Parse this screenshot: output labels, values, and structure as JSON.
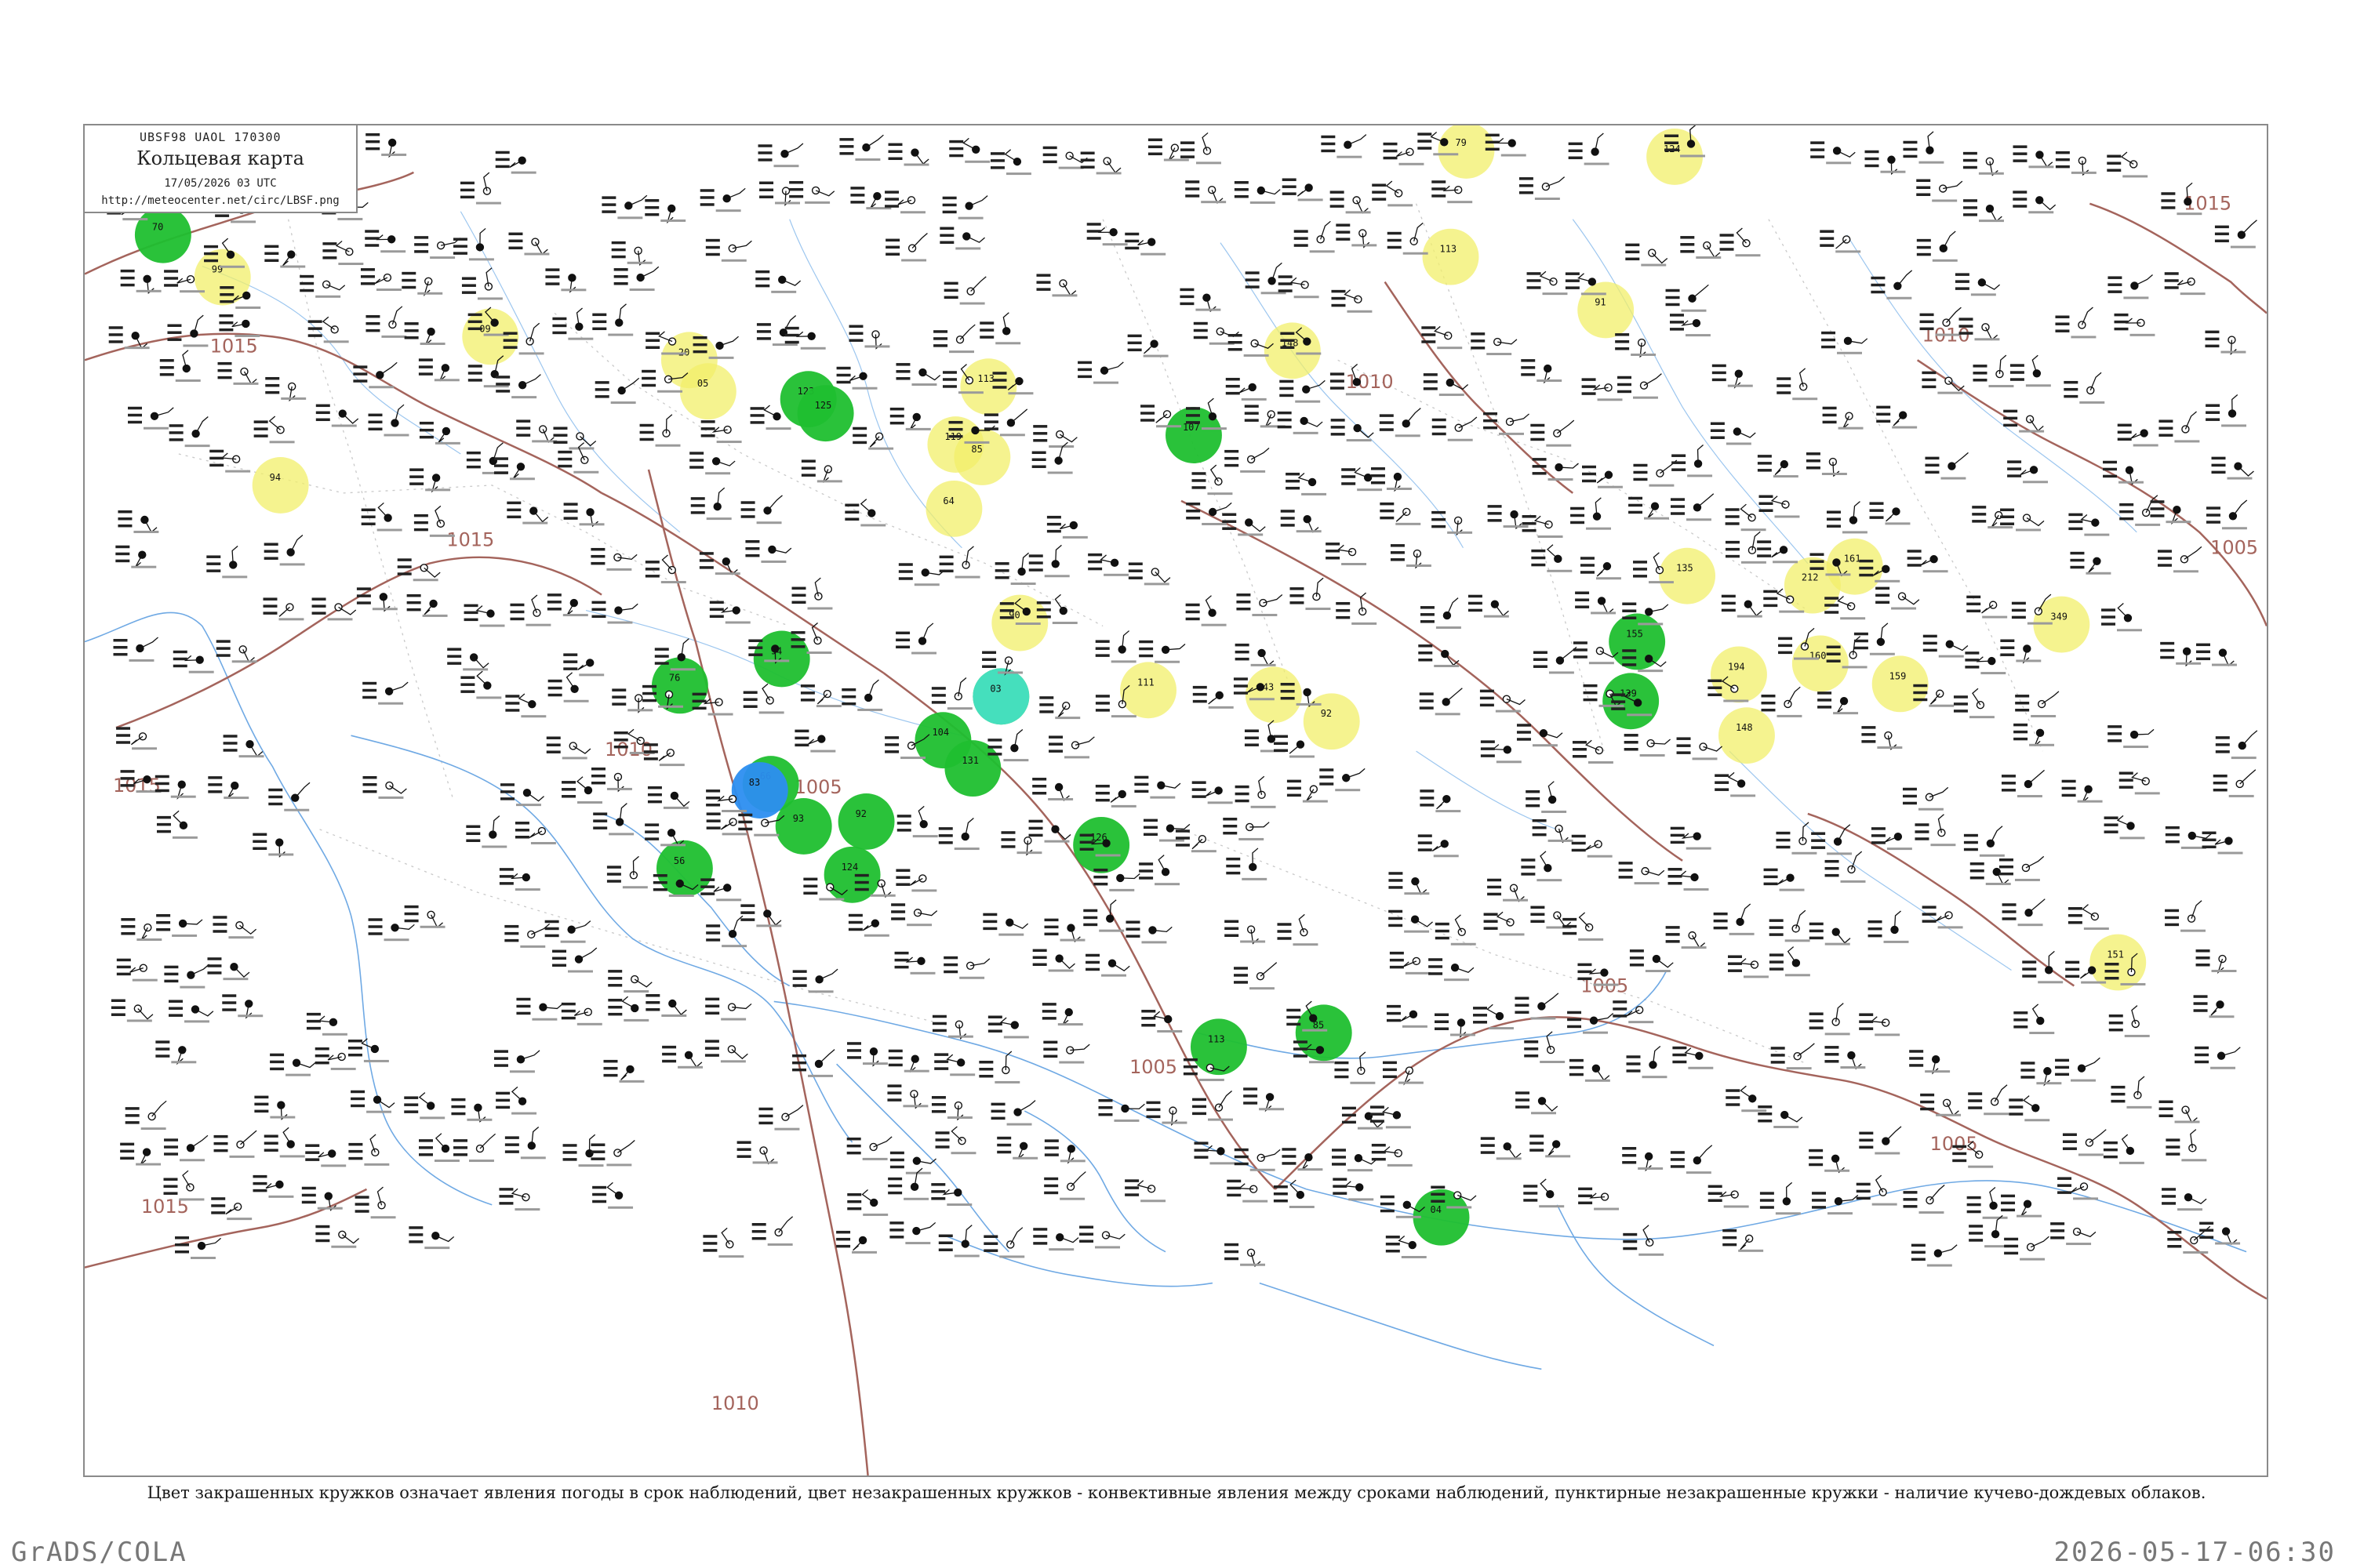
{
  "header": {
    "codes": "UBSF98  UAOL  170300",
    "title": "Кольцевая карта",
    "datetime": "17/05/2026 03 UTC",
    "url": "http://meteocenter.net/circ/LBSF.png"
  },
  "legend_caption": "Цвет закрашенных кружков означает явления погоды в срок наблюдений, цвет незакрашенных кружков - конвективные явления между сроками наблюдений, пунктирные незакрашенные кружки - наличие кучево-дождевых облаков.",
  "footer": {
    "left": "GrADS/COLA",
    "right": "2026-05-17-06:30"
  },
  "colors": {
    "isobar": "#a4645c",
    "coastline": "#6fa9e4",
    "rain": "#1fbf2f",
    "drizzle_or_haze": "#f2ef6a",
    "shower": "#2c8ef0",
    "fog": "#47e0c4",
    "thunder": "#e0527a"
  },
  "isobars": [
    {
      "label": "1015"
    },
    {
      "label": "1015"
    },
    {
      "label": "1015"
    },
    {
      "label": "1015"
    },
    {
      "label": "1010"
    },
    {
      "label": "1010"
    },
    {
      "label": "1010"
    },
    {
      "label": "1010"
    },
    {
      "label": "1005"
    },
    {
      "label": "1005"
    },
    {
      "label": "1005"
    },
    {
      "label": "1005"
    },
    {
      "label": "1005"
    },
    {
      "label": "1015"
    }
  ],
  "stations": [
    {
      "code": "70",
      "type": "rain"
    },
    {
      "code": "99",
      "type": "drizzle_or_haze"
    },
    {
      "code": "09",
      "type": "drizzle_or_haze"
    },
    {
      "code": "94",
      "type": "drizzle_or_haze"
    },
    {
      "code": "20",
      "type": "drizzle_or_haze"
    },
    {
      "code": "05",
      "type": "drizzle_or_haze"
    },
    {
      "code": "123",
      "type": "rain"
    },
    {
      "code": "125",
      "type": "rain"
    },
    {
      "code": "113",
      "type": "drizzle_or_haze"
    },
    {
      "code": "119",
      "type": "drizzle_or_haze"
    },
    {
      "code": "85",
      "type": "drizzle_or_haze"
    },
    {
      "code": "64",
      "type": "drizzle_or_haze"
    },
    {
      "code": "79",
      "type": "drizzle_or_haze"
    },
    {
      "code": "113",
      "type": "drizzle_or_haze"
    },
    {
      "code": "148",
      "type": "drizzle_or_haze"
    },
    {
      "code": "124",
      "type": "drizzle_or_haze"
    },
    {
      "code": "91",
      "type": "drizzle_or_haze"
    },
    {
      "code": "43",
      "type": "drizzle_or_haze"
    },
    {
      "code": "66",
      "type": "rain"
    },
    {
      "code": "76",
      "type": "rain"
    },
    {
      "code": "56",
      "type": "rain"
    },
    {
      "code": "94",
      "type": "rain"
    },
    {
      "code": "83",
      "type": "shower"
    },
    {
      "code": "93",
      "type": "rain"
    },
    {
      "code": "92",
      "type": "rain"
    },
    {
      "code": "124",
      "type": "rain"
    },
    {
      "code": "96",
      "type": "rain"
    },
    {
      "code": "107",
      "type": "rain"
    },
    {
      "code": "03",
      "type": "fog"
    },
    {
      "code": "90",
      "type": "drizzle_or_haze"
    },
    {
      "code": "111",
      "type": "drizzle_or_haze"
    },
    {
      "code": "92",
      "type": "drizzle_or_haze"
    },
    {
      "code": "104",
      "type": "rain"
    },
    {
      "code": "131",
      "type": "rain"
    },
    {
      "code": "126",
      "type": "rain"
    },
    {
      "code": "113",
      "type": "rain"
    },
    {
      "code": "85",
      "type": "rain"
    },
    {
      "code": "04",
      "type": "rain"
    },
    {
      "code": "155",
      "type": "rain"
    },
    {
      "code": "139",
      "type": "rain"
    },
    {
      "code": "194",
      "type": "drizzle_or_haze"
    },
    {
      "code": "148",
      "type": "drizzle_or_haze"
    },
    {
      "code": "135",
      "type": "drizzle_or_haze"
    },
    {
      "code": "161",
      "type": "drizzle_or_haze"
    },
    {
      "code": "159",
      "type": "drizzle_or_haze"
    },
    {
      "code": "212",
      "type": "drizzle_or_haze"
    },
    {
      "code": "160",
      "type": "drizzle_or_haze"
    },
    {
      "code": "349",
      "type": "drizzle_or_haze"
    },
    {
      "code": "151",
      "type": "drizzle_or_haze"
    }
  ]
}
